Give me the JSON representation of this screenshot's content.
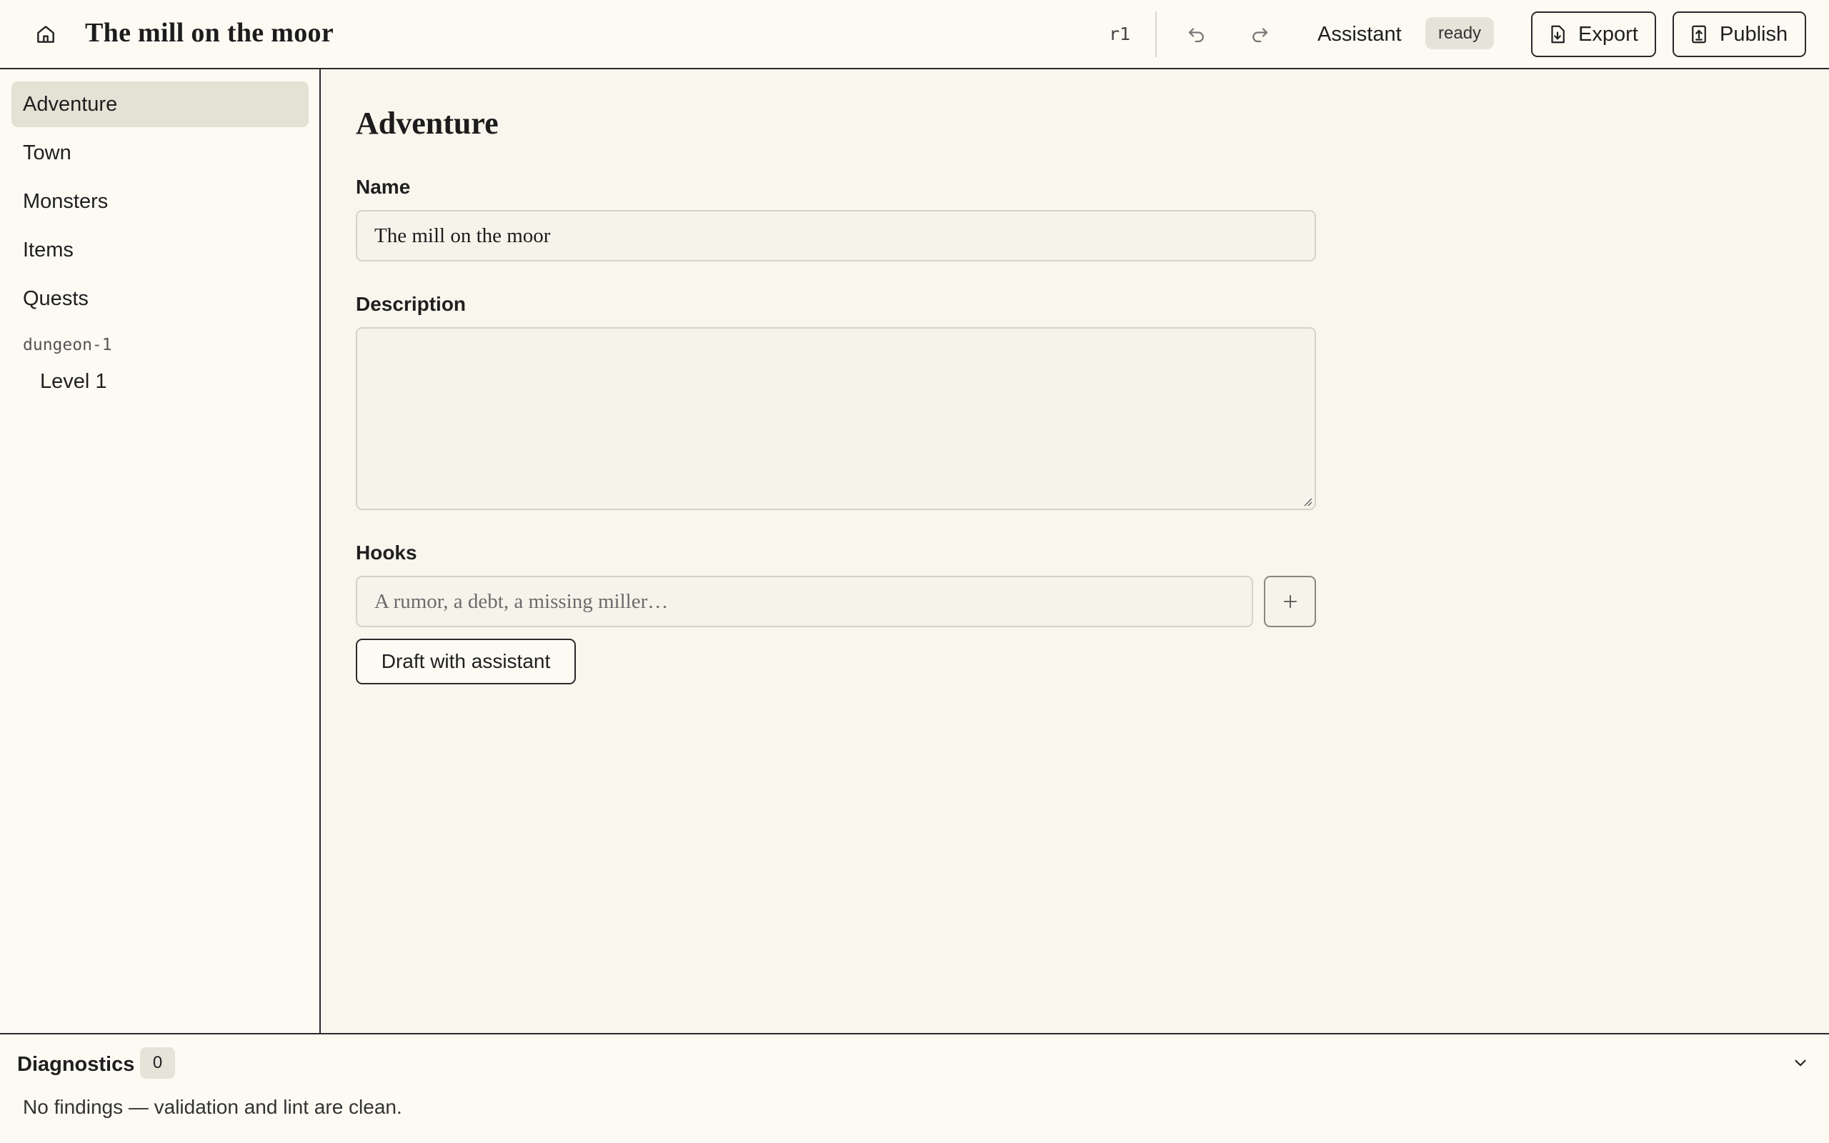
{
  "header": {
    "title": "The mill on the moor",
    "revision": "r1",
    "assistant_label": "Assistant",
    "assistant_status": "ready",
    "export_label": "Export",
    "publish_label": "Publish"
  },
  "sidebar": {
    "items": [
      {
        "label": "Adventure",
        "active": true
      },
      {
        "label": "Town"
      },
      {
        "label": "Monsters"
      },
      {
        "label": "Items"
      },
      {
        "label": "Quests"
      }
    ],
    "section_label": "dungeon-1",
    "section_items": [
      {
        "label": "Level 1"
      }
    ]
  },
  "main": {
    "page_title": "Adventure",
    "name_label": "Name",
    "name_value": "The mill on the moor",
    "description_label": "Description",
    "description_value": "",
    "hooks_label": "Hooks",
    "hooks_placeholder": "A rumor, a debt, a missing miller…",
    "draft_button_label": "Draft with assistant"
  },
  "diagnostics": {
    "title": "Diagnostics",
    "count": "0",
    "message": "No findings — validation and lint are clean."
  },
  "icons": {
    "home": "home-icon",
    "undo": "undo-icon",
    "redo": "redo-icon",
    "export": "file-download-icon",
    "publish": "upload-icon",
    "add": "plus-icon",
    "collapse": "chevron-down-icon"
  },
  "colors": {
    "background": "#faf8f1",
    "border": "#2a2a2a",
    "active_nav": "#e4e1d5",
    "badge": "#e6e3d9"
  }
}
